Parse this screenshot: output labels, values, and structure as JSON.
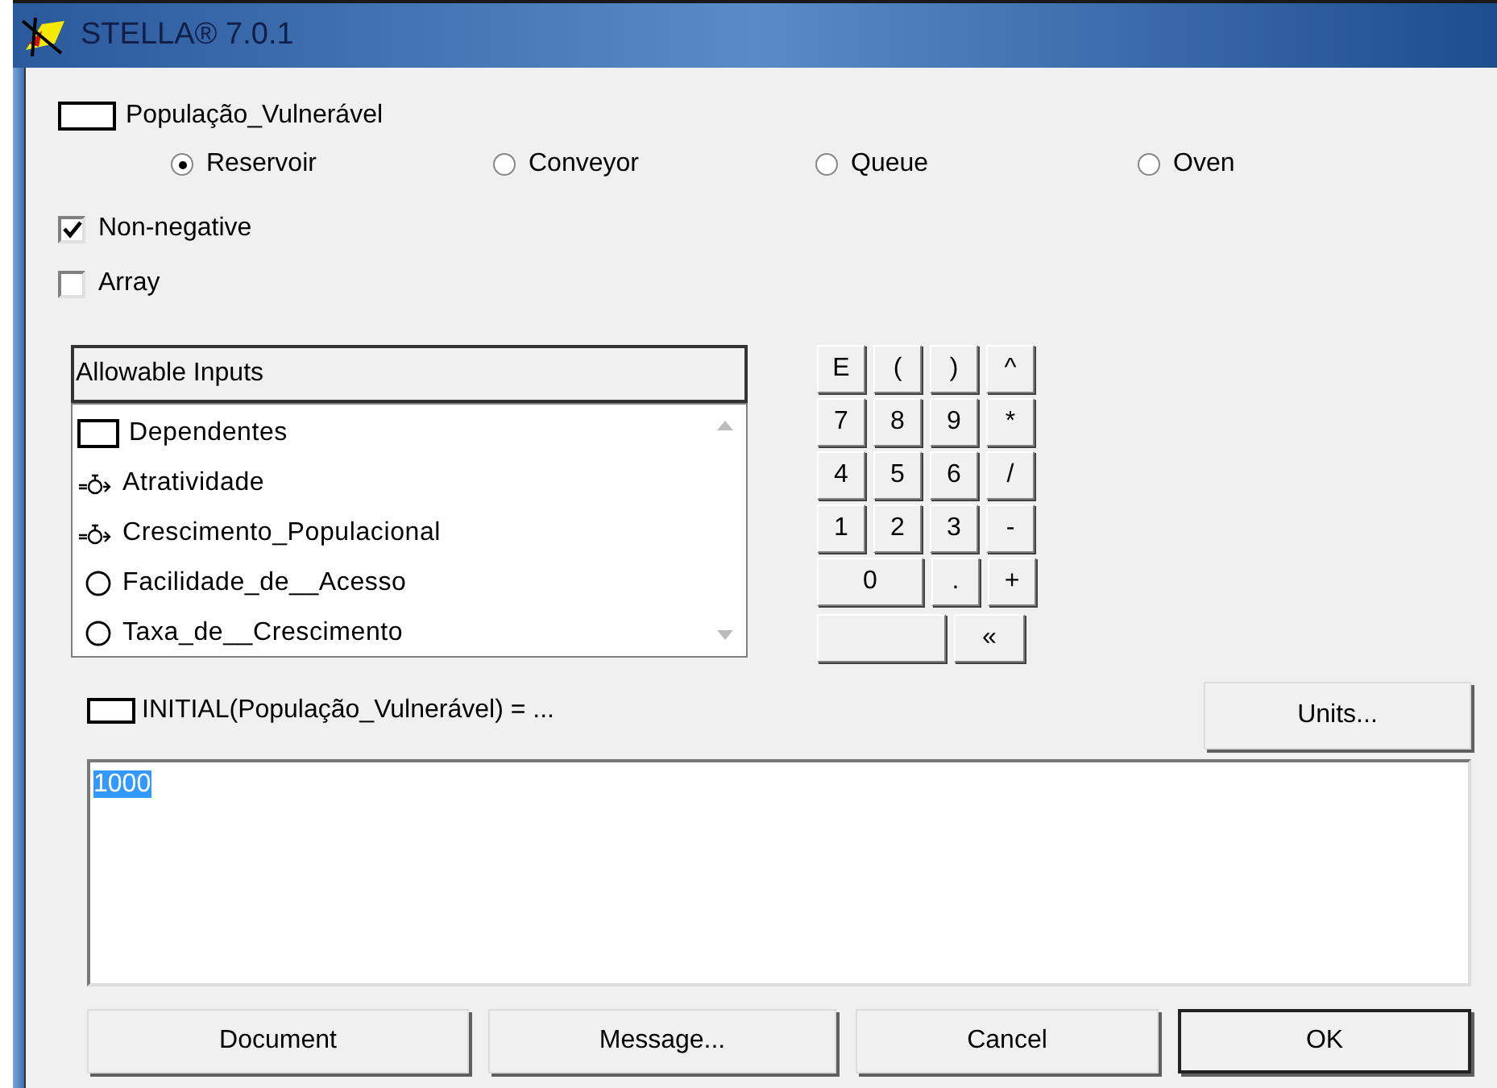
{
  "window": {
    "title": "STELLA® 7.0.1"
  },
  "entity": {
    "name": "População_Vulnerável"
  },
  "types": [
    {
      "label": "Reservoir",
      "selected": true
    },
    {
      "label": "Conveyor",
      "selected": false
    },
    {
      "label": "Queue",
      "selected": false
    },
    {
      "label": "Oven",
      "selected": false
    }
  ],
  "options": [
    {
      "label": "Non-negative",
      "checked": true
    },
    {
      "label": "Array",
      "checked": false
    }
  ],
  "allowable_inputs": {
    "title": "Allowable Inputs",
    "items": [
      {
        "label": "Dependentes",
        "kind": "stock"
      },
      {
        "label": "Atratividade",
        "kind": "flow"
      },
      {
        "label": "Crescimento_Populacional",
        "kind": "flow"
      },
      {
        "label": "Facilidade_de__Acesso",
        "kind": "converter"
      },
      {
        "label": "Taxa_de__Crescimento",
        "kind": "converter"
      }
    ]
  },
  "keypad": [
    [
      {
        "label": "E",
        "kind": "key"
      },
      {
        "label": "(",
        "kind": "key"
      },
      {
        "label": ")",
        "kind": "key"
      },
      {
        "label": "^",
        "kind": "key"
      }
    ],
    [
      {
        "label": "7",
        "kind": "key"
      },
      {
        "label": "8",
        "kind": "key"
      },
      {
        "label": "9",
        "kind": "key"
      },
      {
        "label": "*",
        "kind": "key"
      }
    ],
    [
      {
        "label": "4",
        "kind": "key"
      },
      {
        "label": "5",
        "kind": "key"
      },
      {
        "label": "6",
        "kind": "key"
      },
      {
        "label": "/",
        "kind": "key"
      }
    ],
    [
      {
        "label": "1",
        "kind": "key"
      },
      {
        "label": "2",
        "kind": "key"
      },
      {
        "label": "3",
        "kind": "key"
      },
      {
        "label": "-",
        "kind": "key"
      }
    ],
    [
      {
        "label": "0",
        "kind": "wide"
      },
      {
        "label": ".",
        "kind": "key"
      },
      {
        "label": "+",
        "kind": "key"
      }
    ],
    [
      {
        "kind": "blank"
      },
      {
        "label": "«",
        "kind": "wide"
      }
    ]
  ],
  "equation": {
    "label": "INITIAL(População_Vulnerável) = ...",
    "value": "1000",
    "selected": true
  },
  "units_button": "Units...",
  "buttons": [
    {
      "label": "Document",
      "default": false
    },
    {
      "label": "Message...",
      "default": false
    },
    {
      "label": "Cancel",
      "default": false
    },
    {
      "label": "OK",
      "default": true
    }
  ]
}
